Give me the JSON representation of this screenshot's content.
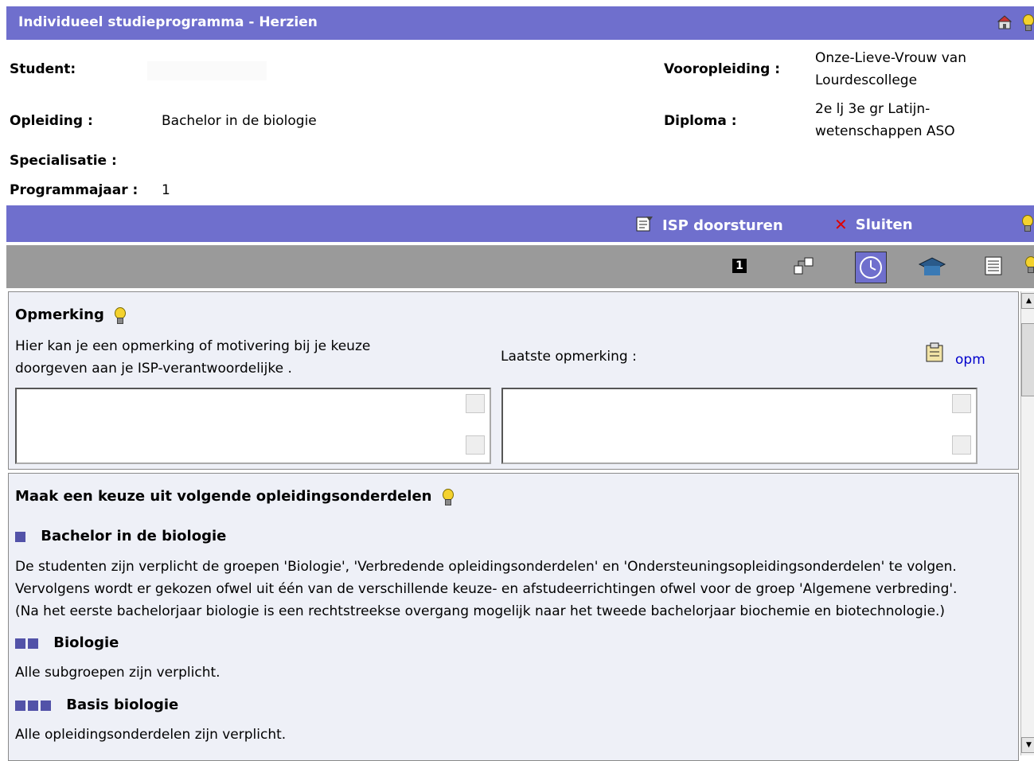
{
  "header": {
    "title": "Individueel studieprogramma - Herzien"
  },
  "info": {
    "student_label": "Student:",
    "student_value": "",
    "opleiding_label": "Opleiding :",
    "opleiding_value": "Bachelor in de biologie",
    "specialisatie_label": "Specialisatie :",
    "programmajaar_label": "Programmajaar :",
    "programmajaar_value": "1",
    "vooropleiding_label": "Vooropleiding :",
    "vooropleiding_value_1": "Onze-Lieve-Vrouw van",
    "vooropleiding_value_2": "Lourdescollege",
    "diploma_label": "Diploma :",
    "diploma_value_1": "2e lj 3e gr Latijn-",
    "diploma_value_2": "wetenschappen ASO"
  },
  "actions": {
    "isp_label": "ISP doorsturen",
    "sluiten_label": "Sluiten"
  },
  "toolbar": {
    "step_number": "1"
  },
  "opmerking": {
    "title": "Opmerking",
    "instruction_1": "Hier kan je een opmerking of motivering bij je keuze",
    "instruction_2": "doorgeven aan je ISP-verantwoordelijke .",
    "laatste_label": "Laatste opmerking :",
    "opm_link": "opm"
  },
  "keuze": {
    "title": "Maak een keuze uit volgende opleidingsonderdelen",
    "group1_title": "Bachelor in de biologie",
    "group1_text_1": "De studenten zijn verplicht de groepen 'Biologie', 'Verbredende opleidingsonderdelen' en 'Ondersteuningsopleidingsonderdelen' te volgen.",
    "group1_text_2": "Vervolgens wordt er gekozen ofwel uit één van de verschillende keuze- en afstudeerrichtingen ofwel voor de groep 'Algemene verbreding'.",
    "group1_text_3": "(Na het eerste bachelorjaar biologie is een rechtstreekse overgang mogelijk naar het tweede bachelorjaar biochemie en biotechnologie.)",
    "group2_title": "Biologie",
    "group2_text": "Alle subgroepen zijn verplicht.",
    "group3_title": "Basis biologie",
    "group3_text": "Alle opleidingsonderdelen zijn verplicht."
  },
  "colors": {
    "bar": "#6f6fcd",
    "toolbar": "#9a9a9a",
    "panel": "#eef0f7",
    "bullet": "#5252a8"
  }
}
